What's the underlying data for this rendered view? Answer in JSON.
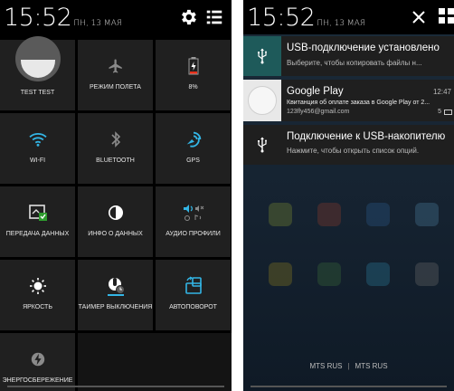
{
  "left": {
    "time": "15:52",
    "date": "ПН, 13 МАЯ",
    "header_icons": [
      "gear-icon",
      "list-icon"
    ],
    "tiles": [
      {
        "label": "TEST TEST",
        "icon": "avatar-icon"
      },
      {
        "label": "РЕЖИМ ПОЛЕТА",
        "icon": "airplane-icon"
      },
      {
        "label": "8%",
        "icon": "battery-icon"
      },
      {
        "label": "WI-FI",
        "icon": "wifi-icon"
      },
      {
        "label": "BLUETOOTH",
        "icon": "bluetooth-icon"
      },
      {
        "label": "GPS",
        "icon": "gps-icon"
      },
      {
        "label": "ПЕРЕДАЧА ДАННЫХ",
        "icon": "data-transfer-icon"
      },
      {
        "label": "ИНФО О ДАННЫХ",
        "icon": "data-usage-icon"
      },
      {
        "label": "АУДИО ПРОФИЛИ",
        "icon": "audio-profile-icon"
      },
      {
        "label": "ЯРКОСТЬ",
        "icon": "brightness-icon"
      },
      {
        "label": "ТАЙМЕР ВЫКЛЮЧЕНИЯ",
        "icon": "sleep-timer-icon"
      },
      {
        "label": "АВТОПОВОРОТ",
        "icon": "rotate-icon"
      },
      {
        "label": "ЭНЕРГОСБЕРЕЖЕНИЕ",
        "icon": "power-saver-icon"
      }
    ]
  },
  "right": {
    "time": "15:52",
    "date": "ПН, 13 МАЯ",
    "header_icons": [
      "close-icon",
      "grid-icon"
    ],
    "notifications": [
      {
        "title": "USB-подключение установлено",
        "subtitle": "Выберите, чтобы копировать файлы н...",
        "icon": "usb-icon"
      },
      {
        "title": "Google Play",
        "time": "12:47",
        "subtitle": "Квитанция об оплате заказа в Google Play от 2...",
        "subtitle2": "123fly456@gmail.com",
        "count": "5",
        "icon": "google-play-icon"
      },
      {
        "title": "Подключение к USB-накопителю",
        "subtitle": "Нажмите, чтобы открыть список опций.",
        "icon": "usb-icon"
      }
    ],
    "carrier_1": "MTS RUS",
    "carrier_sep": "|",
    "carrier_2": "MTS RUS"
  },
  "colors": {
    "accent_blue": "#33b5e5",
    "tile_bg": "#202020",
    "panel_bg": "#000000",
    "notif_bg": "#1f1f1f"
  }
}
